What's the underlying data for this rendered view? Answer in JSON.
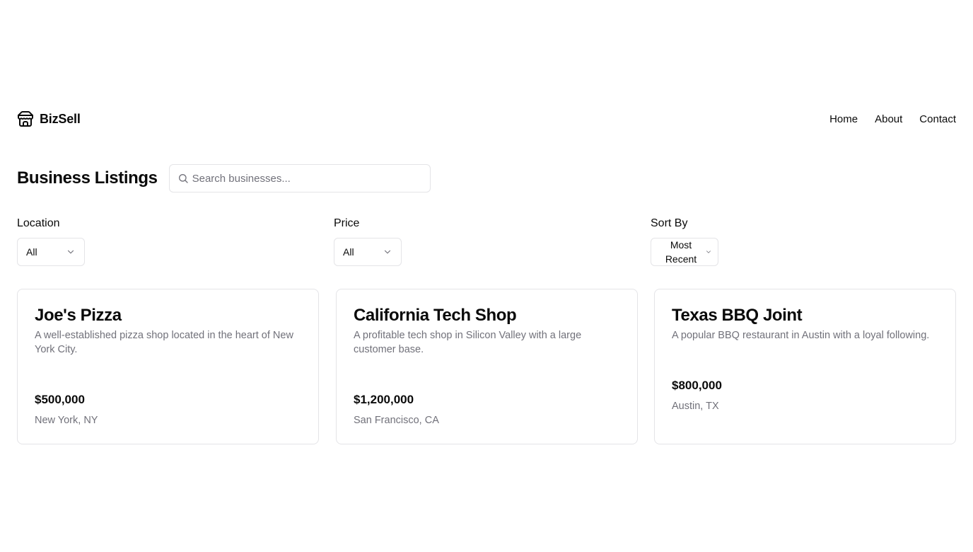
{
  "brand": {
    "name": "BizSell",
    "icon": "store-icon"
  },
  "nav": {
    "home": "Home",
    "about": "About",
    "contact": "Contact"
  },
  "page": {
    "title": "Business Listings"
  },
  "search": {
    "placeholder": "Search businesses...",
    "value": ""
  },
  "filters": {
    "location": {
      "label": "Location",
      "value": "All"
    },
    "price": {
      "label": "Price",
      "value": "All"
    },
    "sort": {
      "label": "Sort By",
      "value": "Most Recent"
    }
  },
  "listings": [
    {
      "title": "Joe's Pizza",
      "description": "A well-established pizza shop located in the heart of New York City.",
      "price": "$500,000",
      "location": "New York, NY"
    },
    {
      "title": "California Tech Shop",
      "description": "A profitable tech shop in Silicon Valley with a large customer base.",
      "price": "$1,200,000",
      "location": "San Francisco, CA"
    },
    {
      "title": "Texas BBQ Joint",
      "description": "A popular BBQ restaurant in Austin with a loyal following.",
      "price": "$800,000",
      "location": "Austin, TX"
    }
  ]
}
